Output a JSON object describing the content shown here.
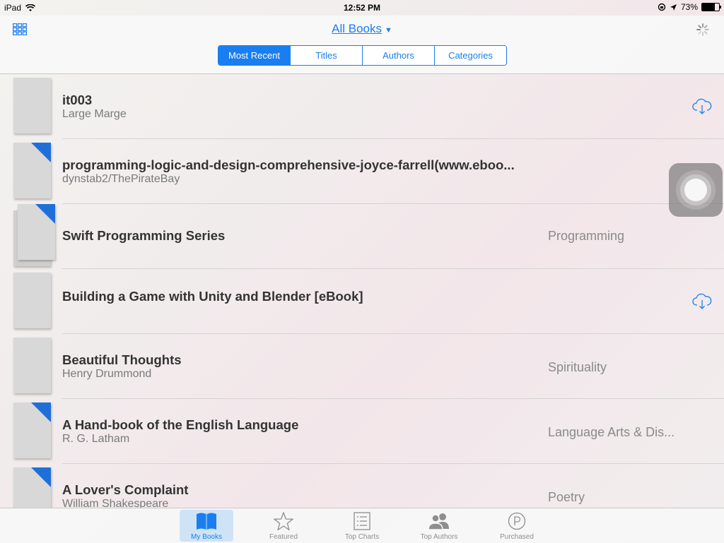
{
  "status_bar": {
    "device": "iPad",
    "time": "12:52 PM",
    "battery": "73%",
    "battery_level": 0.73
  },
  "header": {
    "title": "All Books",
    "segments": [
      {
        "label": "Most Recent",
        "active": true
      },
      {
        "label": "Titles",
        "active": false
      },
      {
        "label": "Authors",
        "active": false
      },
      {
        "label": "Categories",
        "active": false
      }
    ]
  },
  "books": [
    {
      "title": "it003",
      "author": "Large Marge",
      "category": "",
      "ribbon": false,
      "stacked": false,
      "cloud": true
    },
    {
      "title": "programming-logic-and-design-comprehensive-joyce-farrell(www.eboo...",
      "author": "dynstab2/ThePirateBay",
      "category": "",
      "ribbon": true,
      "stacked": false,
      "cloud": false
    },
    {
      "title": "Swift Programming Series",
      "author": "",
      "category": "Programming",
      "ribbon": true,
      "stacked": true,
      "cloud": false
    },
    {
      "title": "Building a Game with Unity and Blender [eBook]",
      "author": "",
      "category": "",
      "ribbon": false,
      "stacked": false,
      "cloud": true
    },
    {
      "title": "Beautiful Thoughts",
      "author": "Henry Drummond",
      "category": "Spirituality",
      "ribbon": false,
      "stacked": false,
      "cloud": false
    },
    {
      "title": "A Hand-book of the English Language",
      "author": "R. G. Latham",
      "category": "Language Arts & Dis...",
      "ribbon": true,
      "stacked": false,
      "cloud": false
    },
    {
      "title": "A Lover's Complaint",
      "author": "William Shakespeare",
      "category": "Poetry",
      "ribbon": true,
      "stacked": false,
      "cloud": false
    }
  ],
  "tabs": [
    {
      "label": "My Books",
      "icon": "book-icon",
      "active": true
    },
    {
      "label": "Featured",
      "icon": "star-icon",
      "active": false
    },
    {
      "label": "Top Charts",
      "icon": "list-icon",
      "active": false
    },
    {
      "label": "Top Authors",
      "icon": "people-icon",
      "active": false
    },
    {
      "label": "Purchased",
      "icon": "purchased-icon",
      "active": false
    }
  ],
  "colors": {
    "accent": "#1a7ef0",
    "ribbon": "#1f6fd9"
  }
}
